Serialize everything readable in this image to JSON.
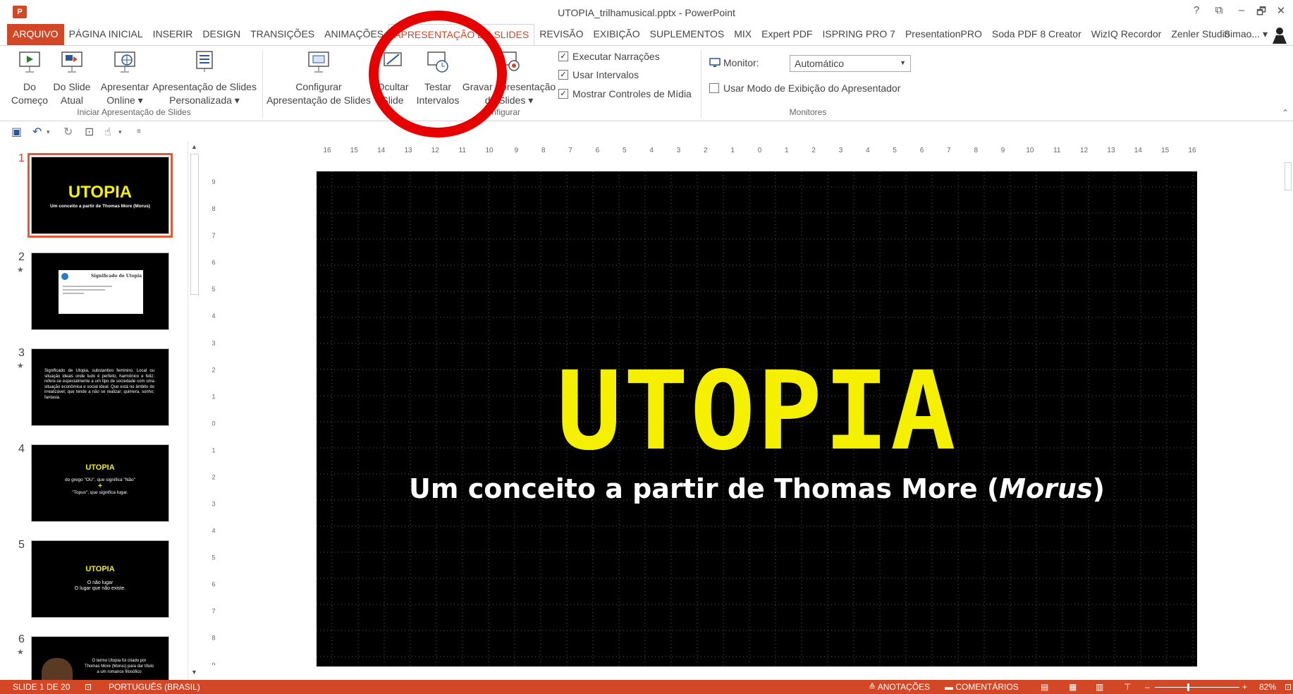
{
  "window": {
    "title": "UTOPIA_trilhamusical.pptx - PowerPoint",
    "app_icon_text": "P",
    "controls": [
      "?",
      "⧉",
      "–",
      "🗗",
      "✕"
    ]
  },
  "tabs": [
    {
      "label": "ARQUIVO",
      "kind": "file"
    },
    {
      "label": "PÁGINA INICIAL"
    },
    {
      "label": "INSERIR"
    },
    {
      "label": "DESIGN"
    },
    {
      "label": "TRANSIÇÕES"
    },
    {
      "label": "ANIMAÇÕES"
    },
    {
      "label": "APRESENTAÇÃO DE SLIDES",
      "kind": "active"
    },
    {
      "label": "REVISÃO"
    },
    {
      "label": "EXIBIÇÃO"
    },
    {
      "label": "SUPLEMENTOS"
    },
    {
      "label": "MIX"
    },
    {
      "label": "Expert PDF"
    },
    {
      "label": "ISPRING PRO 7"
    },
    {
      "label": "PresentationPRO"
    },
    {
      "label": "Soda PDF 8 Creator"
    },
    {
      "label": "WizIQ Recordor"
    },
    {
      "label": "Zenler Studio"
    }
  ],
  "user": {
    "name": "Simao..."
  },
  "ribbon": {
    "groups": {
      "start": "Iniciar Apresentação de Slides",
      "config": "Configurar",
      "monitors": "Monitores"
    },
    "buttons": {
      "from_beginning": [
        "Do",
        "Começo"
      ],
      "from_current": [
        "Do Slide",
        "Atual"
      ],
      "present_online": [
        "Apresentar",
        "Online ▾"
      ],
      "custom_show": [
        "Apresentação de Slides",
        "Personalizada ▾"
      ],
      "setup_show": [
        "Configurar",
        "Apresentação de Slides"
      ],
      "hide_slide": [
        "Ocultar",
        "Slide"
      ],
      "rehearse": [
        "Testar",
        "Intervalos"
      ],
      "record": [
        "Gravar Apresentação",
        "de Slides ▾"
      ]
    },
    "checks": [
      {
        "label": "Executar Narrações",
        "checked": true
      },
      {
        "label": "Usar Intervalos",
        "checked": true
      },
      {
        "label": "Mostrar Controles de Mídia",
        "checked": true
      }
    ],
    "monitor_label": "Monitor:",
    "monitor_value": "Automático",
    "presenter_view": {
      "label": "Usar Modo de Exibição do Apresentador",
      "checked": false
    }
  },
  "ruler": {
    "h_labels": [
      "16",
      "15",
      "14",
      "13",
      "12",
      "11",
      "10",
      "9",
      "8",
      "7",
      "6",
      "5",
      "4",
      "3",
      "2",
      "1",
      "0",
      "1",
      "2",
      "3",
      "4",
      "5",
      "6",
      "7",
      "8",
      "9",
      "10",
      "11",
      "12",
      "13",
      "14",
      "15",
      "16"
    ],
    "v_labels": [
      "9",
      "8",
      "7",
      "6",
      "5",
      "4",
      "3",
      "2",
      "1",
      "0",
      "1",
      "2",
      "3",
      "4",
      "5",
      "6",
      "7",
      "8",
      "9"
    ]
  },
  "thumbnails": [
    {
      "num": "1",
      "star": false,
      "title": "UTOPIA",
      "text": "Um conceito a partir de Thomas More (Morus)"
    },
    {
      "num": "2",
      "star": true,
      "title": "Significado de Utopia",
      "text": ""
    },
    {
      "num": "3",
      "star": true,
      "title": "",
      "text": "Significado de Utopia, substantivo feminino. Local ou situação ideais onde tudo é perfeito, harmônico e feliz; refere-se especialmente a um tipo de sociedade com uma situação econômica e social ideal. Que está no âmbito do irrealizável; que tende a não se realizar; quimera, sonho; fantasia."
    },
    {
      "num": "4",
      "star": false,
      "title": "UTOPIA",
      "text": "do grego \"OU\", que significa \"Não\"",
      "plus": "+",
      "text2": "\"Topus\", que significa lugar."
    },
    {
      "num": "5",
      "star": false,
      "title": "UTOPIA",
      "text": "O não lugar",
      "text2": "O lugar que não existe."
    },
    {
      "num": "6",
      "star": true,
      "title": "",
      "text": "O termo Utopia foi criado por Thomas More (Morus) para dar título a um romance filosófico"
    }
  ],
  "slide": {
    "title": "UTOPIA",
    "subtitle_pre": "Um conceito a partir de Thomas More (",
    "subtitle_em": "Morus",
    "subtitle_post": ")",
    "title_color": "#f5ef00"
  },
  "status": {
    "slide_counter": "SLIDE 1 DE 20",
    "language": "PORTUGUÊS (BRASIL)",
    "notes": "ANOTAÇÕES",
    "comments": "COMENTÁRIOS",
    "zoom": "82%"
  },
  "colors": {
    "accent": "#d24726",
    "annotation_circle": "#e60000"
  }
}
